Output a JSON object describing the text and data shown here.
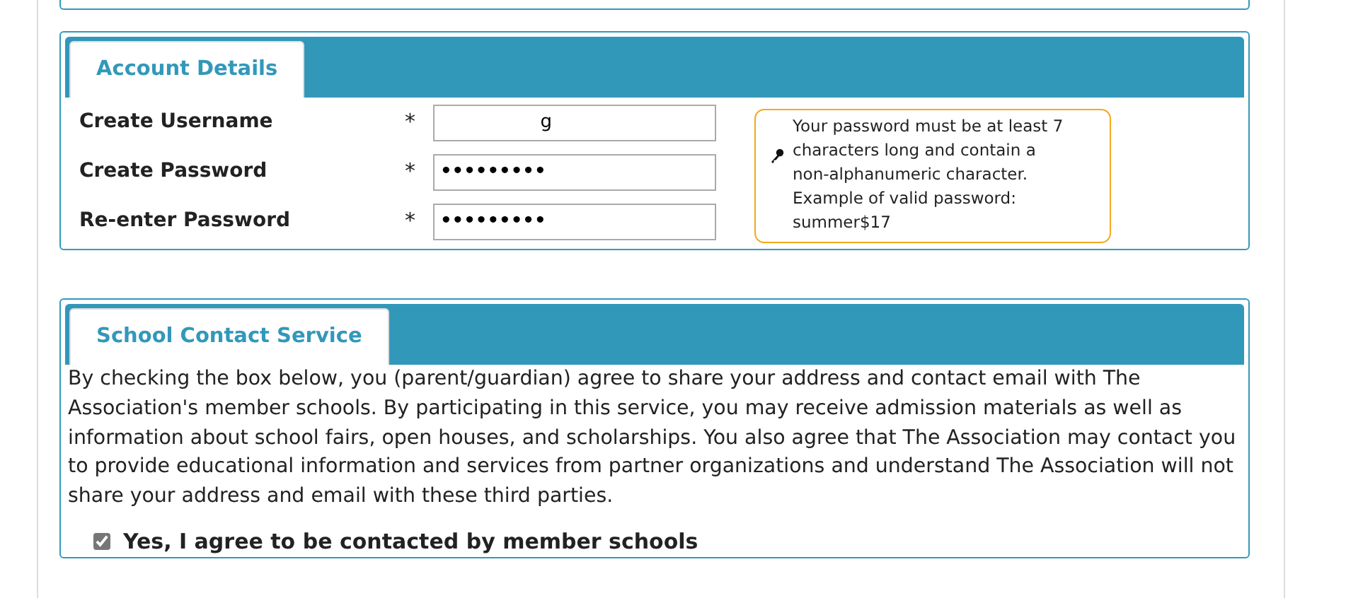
{
  "sections": [
    {
      "title": "Account Details",
      "kind": "form",
      "fields": [
        {
          "label": "Create Username",
          "required": "*",
          "value": "g",
          "masked": false
        },
        {
          "label": "Create Password",
          "required": "*",
          "value": "•••••••••",
          "masked": true
        },
        {
          "label": "Re-enter Password",
          "required": "*",
          "value": "•••••••••",
          "masked": true
        }
      ],
      "hint": "Your password must be at least 7 characters long and contain a non-alphanumeric character. Example of valid password: summer$17"
    },
    {
      "title": "School Contact Service",
      "kind": "consent",
      "text": "By checking the box below, you (parent/guardian) agree to share your address and contact email with The Association's member schools. By participating in this service, you may receive admission materials as well as information about school fairs, open houses, and scholarships. You also agree that The Association may contact you to provide educational information and services from partner organizations and understand The Association will not share your address and email with these third parties.",
      "checkbox": {
        "label": "Yes, I agree to be contacted by member schools",
        "checked": true
      }
    }
  ]
}
